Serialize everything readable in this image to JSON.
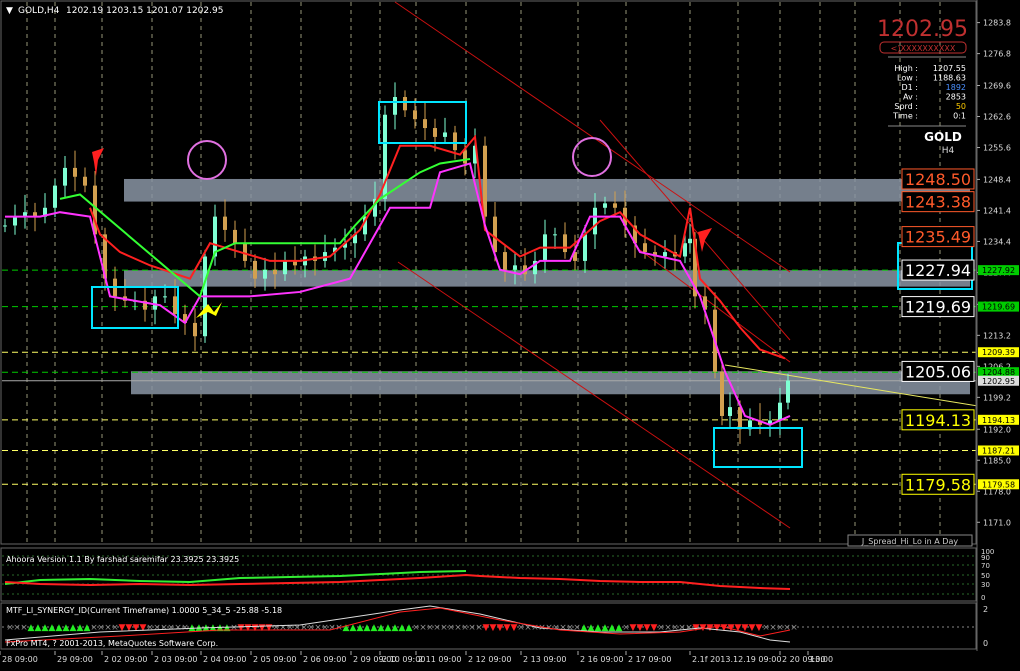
{
  "header": {
    "symbol": "GOLD,H4",
    "ohlc": "1202.19 1203.15 1201.07 1202.95"
  },
  "price_panel": {
    "big_price": "1202.95",
    "bid_label": "<)XXXXXXXXXX",
    "rows": [
      {
        "label": "High :",
        "value": "1207.55"
      },
      {
        "label": "Low :",
        "value": "1188.63"
      },
      {
        "label": "D1 :",
        "value": "1892"
      },
      {
        "label": "Av :",
        "value": "2853"
      },
      {
        "label": "Sprd :",
        "value": "50"
      },
      {
        "label": "Time :",
        "value": "0:1"
      }
    ],
    "symbol": "GOLD",
    "timeframe": "H4"
  },
  "level_labels": [
    {
      "text": "1248.50",
      "price": 1248.5,
      "color": "#ff5a2a"
    },
    {
      "text": "1243.38",
      "price": 1243.38,
      "color": "#ff5a2a"
    },
    {
      "text": "1235.49",
      "price": 1235.49,
      "color": "#ff5a2a"
    },
    {
      "text": "1227.94",
      "price": 1227.94,
      "color": "#ffffff"
    },
    {
      "text": "1219.69",
      "price": 1219.69,
      "color": "#ffffff"
    },
    {
      "text": "1205.06",
      "price": 1205.06,
      "color": "#ffffff"
    },
    {
      "text": "1194.13",
      "price": 1194.13,
      "color": "#ffff00"
    },
    {
      "text": "1179.58",
      "price": 1179.58,
      "color": "#ffff00"
    }
  ],
  "axis_tags": [
    {
      "text": "1227.92",
      "price": 1227.92,
      "bg": "#00cc00",
      "fg": "#000000"
    },
    {
      "text": "1219.69",
      "price": 1219.69,
      "bg": "#00cc00",
      "fg": "#000000"
    },
    {
      "text": "1209.39",
      "price": 1209.39,
      "bg": "#ffff00",
      "fg": "#000000"
    },
    {
      "text": "1204.88",
      "price": 1204.88,
      "bg": "#00cc00",
      "fg": "#000000"
    },
    {
      "text": "1202.95",
      "price": 1202.95,
      "bg": "#dddddd",
      "fg": "#000000"
    },
    {
      "text": "1194.13",
      "price": 1194.13,
      "bg": "#ffff00",
      "fg": "#000000"
    },
    {
      "text": "1187.21",
      "price": 1187.21,
      "bg": "#ffff00",
      "fg": "#000000"
    },
    {
      "text": "1179.58",
      "price": 1179.58,
      "bg": "#ffff00",
      "fg": "#000000"
    }
  ],
  "spread_label": "J_Spread_Hi_Lo in A Day",
  "indicator1": {
    "title": "Ahoora Version 1.1 By farshad saremifar  23.3925 23.3925",
    "axis": [
      "100",
      "90",
      "70",
      "50",
      "30",
      "0"
    ]
  },
  "indicator2": {
    "title": "MTF_LI_SYNERGY_ID(Current Timeframe) 1.0000  5_34_5 -25.88 -5.18",
    "axis": [
      "2",
      "0"
    ]
  },
  "copyright": "FxPro MT4, ? 2001-2013, MetaQuotes Software Corp.",
  "time_axis": [
    "28 09:00",
    "29 09:00",
    "2 02 09:00",
    "2 03 09:00",
    "2 04 09:00",
    "2 05 09:00",
    "2 06 09:00",
    "2 09 09:00",
    "2 10 09:00",
    "2 11 09:00",
    "2 12 09:00",
    "2 13 09:00",
    "2 16 09:00",
    "2 17 09:00",
    "2.1f 2013.12.19 09:00",
    "2 20 09:00",
    "13:00"
  ],
  "colors": {
    "background": "#000000",
    "grid": "#c8c8a0",
    "candle_bull": "#7fffd4",
    "candle_bear": "#d2a050",
    "ma_red": "#ff2020",
    "ma_magenta": "#ff33ff",
    "ma_green": "#33ff33",
    "zone": "#8a95a5",
    "box": "#00e5ff",
    "channel": "#cc1010"
  },
  "chart_data": {
    "type": "candlestick",
    "symbol": "GOLD",
    "timeframe": "H4",
    "y_ticks": [
      1283.8,
      1276.8,
      1269.6,
      1262.6,
      1255.6,
      1248.4,
      1241.4,
      1234.4,
      1227.4,
      1220.2,
      1213.2,
      1206.2,
      1199.2,
      1192.0,
      1185.0,
      1178.0,
      1171.0
    ],
    "ylim": [
      1167,
      1288
    ],
    "resistance_zones": [
      [
        1243.4,
        1248.5
      ],
      [
        1224.2,
        1227.9
      ],
      [
        1199.9,
        1205.1
      ]
    ],
    "horizontal_lines": [
      1227.92,
      1219.69,
      1209.39,
      1204.88,
      1194.13,
      1187.21,
      1179.58
    ]
  }
}
